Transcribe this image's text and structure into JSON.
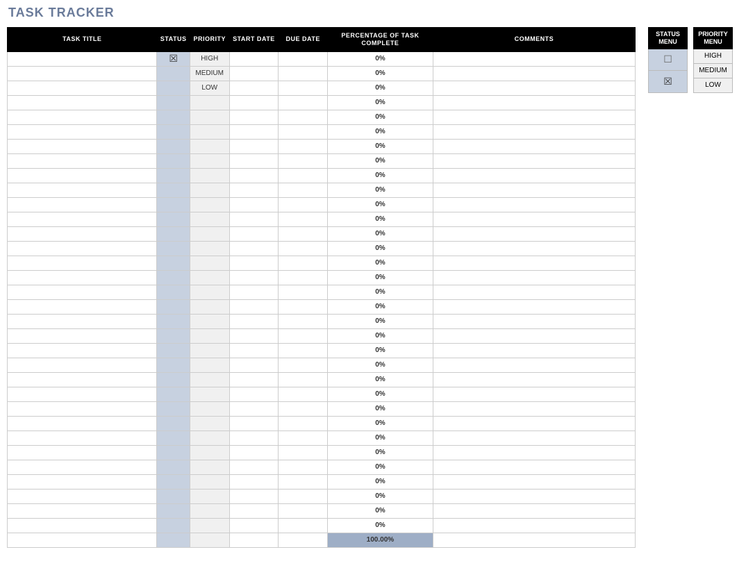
{
  "title": "TASK TRACKER",
  "columns": {
    "title": "TASK TITLE",
    "status": "STATUS",
    "priority": "PRIORITY",
    "start": "START DATE",
    "due": "DUE DATE",
    "pct": "PERCENTAGE OF TASK COMPLETE",
    "comments": "COMMENTS"
  },
  "rows": [
    {
      "title": "",
      "status": "checked",
      "priority": "HIGH",
      "start": "",
      "due": "",
      "pct": "0%",
      "comments": ""
    },
    {
      "title": "",
      "status": "",
      "priority": "MEDIUM",
      "start": "",
      "due": "",
      "pct": "0%",
      "comments": ""
    },
    {
      "title": "",
      "status": "",
      "priority": "LOW",
      "start": "",
      "due": "",
      "pct": "0%",
      "comments": ""
    },
    {
      "title": "",
      "status": "",
      "priority": "",
      "start": "",
      "due": "",
      "pct": "0%",
      "comments": ""
    },
    {
      "title": "",
      "status": "",
      "priority": "",
      "start": "",
      "due": "",
      "pct": "0%",
      "comments": ""
    },
    {
      "title": "",
      "status": "",
      "priority": "",
      "start": "",
      "due": "",
      "pct": "0%",
      "comments": ""
    },
    {
      "title": "",
      "status": "",
      "priority": "",
      "start": "",
      "due": "",
      "pct": "0%",
      "comments": ""
    },
    {
      "title": "",
      "status": "",
      "priority": "",
      "start": "",
      "due": "",
      "pct": "0%",
      "comments": ""
    },
    {
      "title": "",
      "status": "",
      "priority": "",
      "start": "",
      "due": "",
      "pct": "0%",
      "comments": ""
    },
    {
      "title": "",
      "status": "",
      "priority": "",
      "start": "",
      "due": "",
      "pct": "0%",
      "comments": ""
    },
    {
      "title": "",
      "status": "",
      "priority": "",
      "start": "",
      "due": "",
      "pct": "0%",
      "comments": ""
    },
    {
      "title": "",
      "status": "",
      "priority": "",
      "start": "",
      "due": "",
      "pct": "0%",
      "comments": ""
    },
    {
      "title": "",
      "status": "",
      "priority": "",
      "start": "",
      "due": "",
      "pct": "0%",
      "comments": ""
    },
    {
      "title": "",
      "status": "",
      "priority": "",
      "start": "",
      "due": "",
      "pct": "0%",
      "comments": ""
    },
    {
      "title": "",
      "status": "",
      "priority": "",
      "start": "",
      "due": "",
      "pct": "0%",
      "comments": ""
    },
    {
      "title": "",
      "status": "",
      "priority": "",
      "start": "",
      "due": "",
      "pct": "0%",
      "comments": ""
    },
    {
      "title": "",
      "status": "",
      "priority": "",
      "start": "",
      "due": "",
      "pct": "0%",
      "comments": ""
    },
    {
      "title": "",
      "status": "",
      "priority": "",
      "start": "",
      "due": "",
      "pct": "0%",
      "comments": ""
    },
    {
      "title": "",
      "status": "",
      "priority": "",
      "start": "",
      "due": "",
      "pct": "0%",
      "comments": ""
    },
    {
      "title": "",
      "status": "",
      "priority": "",
      "start": "",
      "due": "",
      "pct": "0%",
      "comments": ""
    },
    {
      "title": "",
      "status": "",
      "priority": "",
      "start": "",
      "due": "",
      "pct": "0%",
      "comments": ""
    },
    {
      "title": "",
      "status": "",
      "priority": "",
      "start": "",
      "due": "",
      "pct": "0%",
      "comments": ""
    },
    {
      "title": "",
      "status": "",
      "priority": "",
      "start": "",
      "due": "",
      "pct": "0%",
      "comments": ""
    },
    {
      "title": "",
      "status": "",
      "priority": "",
      "start": "",
      "due": "",
      "pct": "0%",
      "comments": ""
    },
    {
      "title": "",
      "status": "",
      "priority": "",
      "start": "",
      "due": "",
      "pct": "0%",
      "comments": ""
    },
    {
      "title": "",
      "status": "",
      "priority": "",
      "start": "",
      "due": "",
      "pct": "0%",
      "comments": ""
    },
    {
      "title": "",
      "status": "",
      "priority": "",
      "start": "",
      "due": "",
      "pct": "0%",
      "comments": ""
    },
    {
      "title": "",
      "status": "",
      "priority": "",
      "start": "",
      "due": "",
      "pct": "0%",
      "comments": ""
    },
    {
      "title": "",
      "status": "",
      "priority": "",
      "start": "",
      "due": "",
      "pct": "0%",
      "comments": ""
    },
    {
      "title": "",
      "status": "",
      "priority": "",
      "start": "",
      "due": "",
      "pct": "0%",
      "comments": ""
    },
    {
      "title": "",
      "status": "",
      "priority": "",
      "start": "",
      "due": "",
      "pct": "0%",
      "comments": ""
    },
    {
      "title": "",
      "status": "",
      "priority": "",
      "start": "",
      "due": "",
      "pct": "0%",
      "comments": ""
    },
    {
      "title": "",
      "status": "",
      "priority": "",
      "start": "",
      "due": "",
      "pct": "0%",
      "comments": ""
    }
  ],
  "footer_pct": "100.00%",
  "status_menu": {
    "header": "STATUS MENU",
    "items": [
      "unchecked",
      "checked"
    ]
  },
  "priority_menu": {
    "header": "PRIORITY MENU",
    "items": [
      "HIGH",
      "MEDIUM",
      "LOW"
    ]
  }
}
